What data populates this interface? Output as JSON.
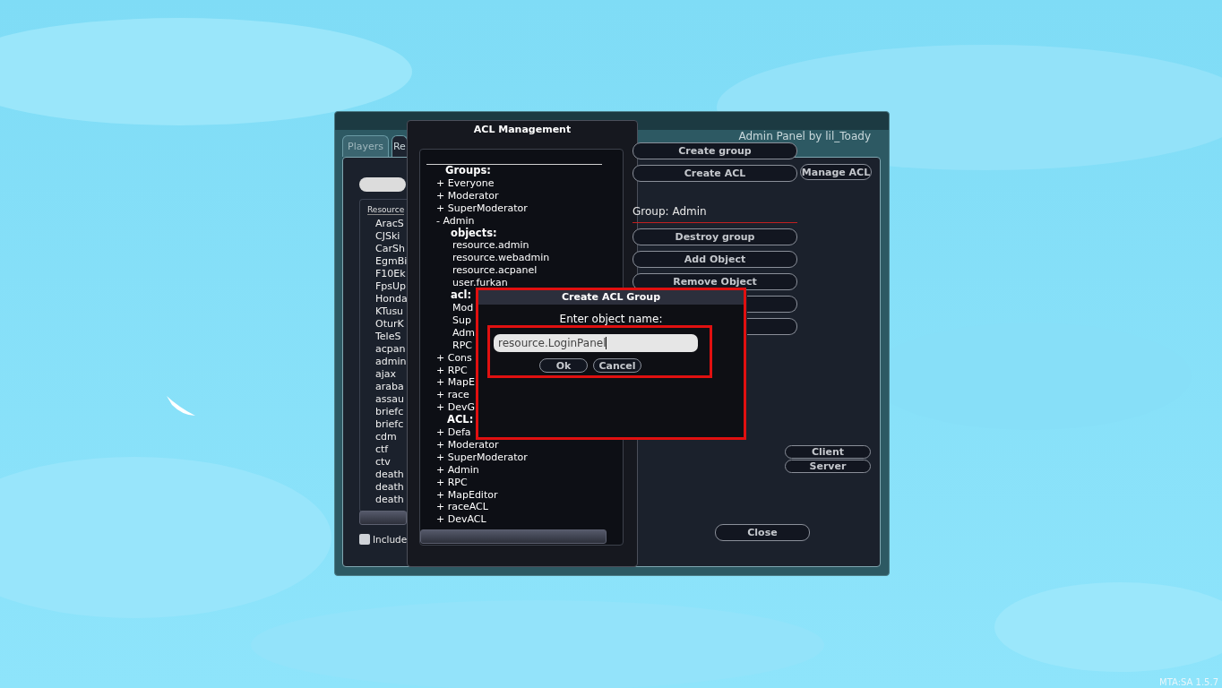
{
  "admin_window": {
    "tabs": [
      {
        "label": "Players",
        "selected": false
      },
      {
        "label": "Re",
        "selected": true
      }
    ],
    "byline": "Admin Panel by lil_Toady",
    "manage_acl_button": "Manage ACL",
    "resource_list": {
      "header": "Resource",
      "items": [
        "AracS",
        "CJSki",
        "CarSh",
        "EgmBi",
        "F10Ek",
        "FpsUp",
        "Honda",
        "KTusu",
        "OturK",
        "TeleS",
        "acpan",
        "admin",
        "ajax",
        "araba",
        "assau",
        "briefc",
        "briefc",
        "cdm",
        "ctf",
        "ctv",
        "death",
        "death",
        "death"
      ]
    },
    "include_checkbox": {
      "label": "Include",
      "checked": false
    },
    "run_buttons": [
      "Client",
      "Server"
    ],
    "close_button": "Close"
  },
  "acl_window": {
    "title": "ACL Management",
    "groups_label": "Groups:",
    "groups": [
      {
        "sign": "+",
        "name": "Everyone"
      },
      {
        "sign": "+",
        "name": "Moderator"
      },
      {
        "sign": "+",
        "name": "SuperModerator"
      },
      {
        "sign": "-",
        "name": "Admin",
        "children": [
          {
            "label": "objects:",
            "items": [
              "resource.admin",
              "resource.webadmin",
              "resource.acpanel",
              "user.furkan"
            ]
          },
          {
            "label": "acl:",
            "items": [
              "Mod",
              "Sup",
              "Adm",
              "RPC"
            ]
          }
        ]
      },
      {
        "sign": "+",
        "name": "Cons"
      },
      {
        "sign": "+",
        "name": "RPC"
      },
      {
        "sign": "+",
        "name": "MapE"
      },
      {
        "sign": "+",
        "name": "race"
      },
      {
        "sign": "+",
        "name": "DevG"
      }
    ],
    "acl_label": "ACL:",
    "acls": [
      {
        "sign": "+",
        "name": "Defa"
      },
      {
        "sign": "+",
        "name": "Moderator"
      },
      {
        "sign": "+",
        "name": "SuperModerator"
      },
      {
        "sign": "+",
        "name": "Admin"
      },
      {
        "sign": "+",
        "name": "RPC"
      },
      {
        "sign": "+",
        "name": "MapEditor"
      },
      {
        "sign": "+",
        "name": "raceACL"
      },
      {
        "sign": "+",
        "name": "DevACL"
      }
    ],
    "top_buttons": [
      "Create group",
      "Create ACL"
    ],
    "group_heading": "Group: Admin",
    "group_buttons": [
      "Destroy group",
      "Add Object",
      "Remove Object"
    ]
  },
  "dialog": {
    "title": "Create ACL Group",
    "prompt": "Enter object name:",
    "value": "resource.LoginPanel",
    "buttons": [
      "Ok",
      "Cancel"
    ]
  },
  "version": "MTA:SA 1.5.7"
}
